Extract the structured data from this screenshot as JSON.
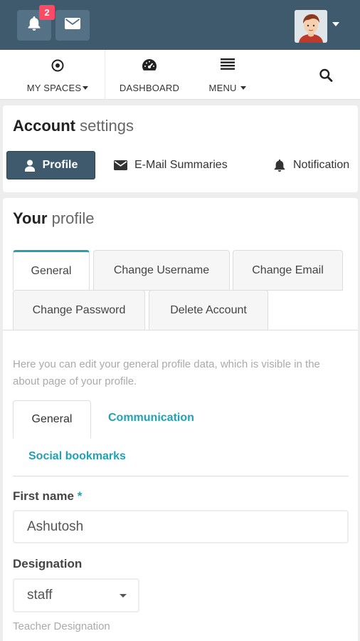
{
  "topbar": {
    "notification_count": "2",
    "bell_icon": "bell-icon",
    "mail_icon": "envelope-icon",
    "avatar_icon": "user-avatar"
  },
  "nav": {
    "items": [
      {
        "label": "MY SPACES",
        "icon": "target-icon"
      },
      {
        "label": "DASHBOARD",
        "icon": "dashboard-icon"
      },
      {
        "label": "MENU",
        "icon": "menu-icon"
      }
    ],
    "search_icon": "search-icon"
  },
  "account": {
    "title_bold": "Account",
    "title_light": "settings",
    "tabs": [
      {
        "label": "Profile",
        "icon": "user-icon"
      },
      {
        "label": "E-Mail Summaries",
        "icon": "envelope-icon"
      },
      {
        "label": "Notification",
        "icon": "bell-icon"
      }
    ]
  },
  "profile": {
    "title_bold": "Your",
    "title_light": "profile",
    "tabs": [
      "General",
      "Change Username",
      "Change Email",
      "Change Password",
      "Delete Account"
    ],
    "description": "Here you can edit your general profile data, which is visible in the about page of your profile.",
    "subtabs": [
      "General",
      "Communication",
      "Social bookmarks"
    ],
    "first_name_label": "First name",
    "required_mark": "*",
    "first_name_value": "Ashutosh",
    "designation_label": "Designation",
    "designation_value": "staff",
    "designation_help": "Teacher Designation"
  },
  "colors": {
    "topbar": "#3f5a6c",
    "accent": "#21a1b3",
    "badge": "#fc4a64"
  }
}
